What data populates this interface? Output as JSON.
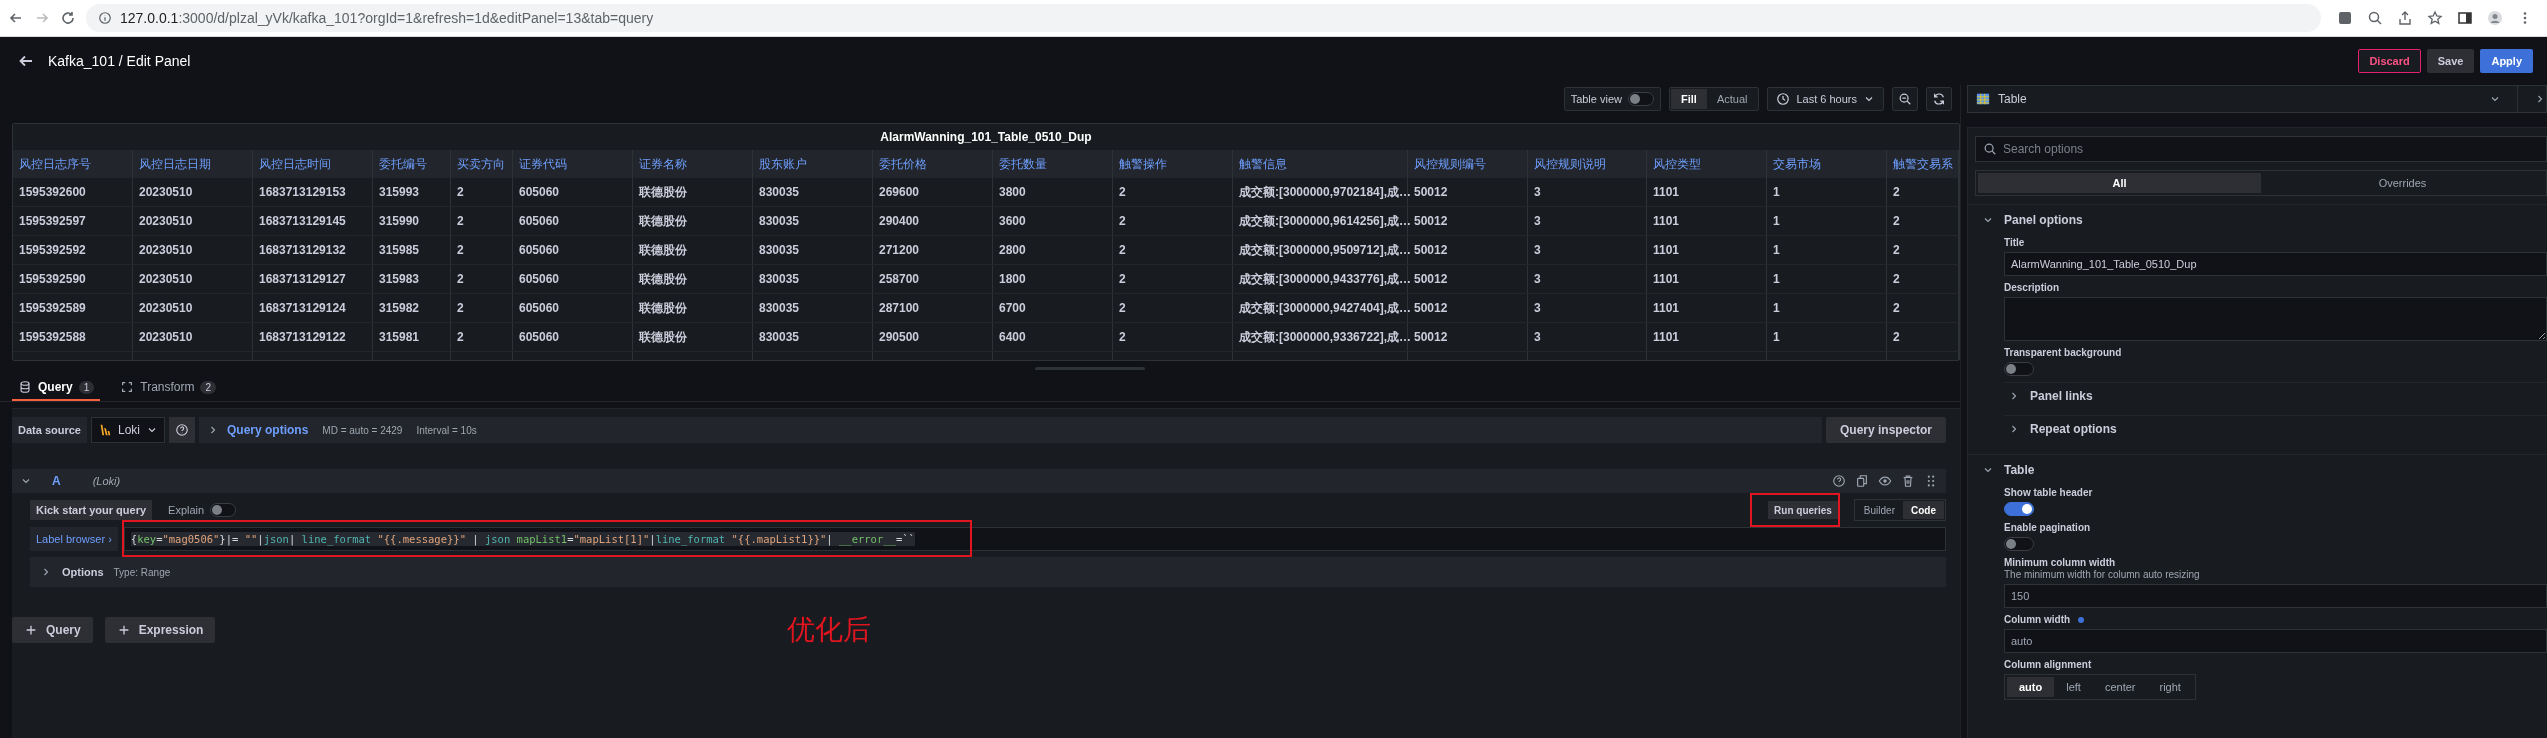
{
  "browser": {
    "host": "127.0.0.1",
    "path": ":3000/d/plzal_yVk/kafka_101?orgId=1&refresh=1d&editPanel=13&tab=query"
  },
  "header": {
    "title": "Kafka_101 / Edit Panel",
    "buttons": [
      {
        "label": "Discard",
        "kind": "danger"
      },
      {
        "label": "Save",
        "kind": "secondary"
      },
      {
        "label": "Apply",
        "kind": "primary"
      }
    ]
  },
  "toolbar": {
    "table_view": {
      "label": "Table view",
      "on": false
    },
    "size_modes": [
      {
        "label": "Fill",
        "selected": true
      },
      {
        "label": "Actual",
        "selected": false
      }
    ],
    "time_range": "Last 6 hours"
  },
  "panel": {
    "title": "AlarmWanning_101_Table_0510_Dup",
    "columns": [
      "风控日志序号",
      "风控日志日期",
      "风控日志时间",
      "委托编号",
      "买卖方向",
      "证券代码",
      "证券名称",
      "股东账户",
      "委托价格",
      "委托数量",
      "触警操作",
      "触警信息",
      "风控规则编号",
      "风控规则说明",
      "风控类型",
      "交易市场",
      "触警交易系"
    ],
    "rows": [
      [
        "1595392600",
        "20230510",
        "1683713129153",
        "315993",
        "2",
        "605060",
        "联德股份",
        "830035",
        "269600",
        "3800",
        "2",
        "成交额:[3000000,9702184],成…",
        "50012",
        "3",
        "1101",
        "1",
        "2"
      ],
      [
        "1595392597",
        "20230510",
        "1683713129145",
        "315990",
        "2",
        "605060",
        "联德股份",
        "830035",
        "290400",
        "3600",
        "2",
        "成交额:[3000000,9614256],成…",
        "50012",
        "3",
        "1101",
        "1",
        "2"
      ],
      [
        "1595392592",
        "20230510",
        "1683713129132",
        "315985",
        "2",
        "605060",
        "联德股份",
        "830035",
        "271200",
        "2800",
        "2",
        "成交额:[3000000,9509712],成…",
        "50012",
        "3",
        "1101",
        "1",
        "2"
      ],
      [
        "1595392590",
        "20230510",
        "1683713129127",
        "315983",
        "2",
        "605060",
        "联德股份",
        "830035",
        "258700",
        "1800",
        "2",
        "成交额:[3000000,9433776],成…",
        "50012",
        "3",
        "1101",
        "1",
        "2"
      ],
      [
        "1595392589",
        "20230510",
        "1683713129124",
        "315982",
        "2",
        "605060",
        "联德股份",
        "830035",
        "287100",
        "6700",
        "2",
        "成交额:[3000000,9427404],成…",
        "50012",
        "3",
        "1101",
        "1",
        "2"
      ],
      [
        "1595392588",
        "20230510",
        "1683713129122",
        "315981",
        "2",
        "605060",
        "联德股份",
        "830035",
        "290500",
        "6400",
        "2",
        "成交额:[3000000,9336722],成…",
        "50012",
        "3",
        "1101",
        "1",
        "2"
      ]
    ]
  },
  "query_tabs": [
    {
      "label": "Query",
      "count": "1",
      "selected": true
    },
    {
      "label": "Transform",
      "count": "2",
      "selected": false
    }
  ],
  "data_source": {
    "label": "Data source",
    "value": "Loki",
    "query_options": "Query options",
    "max_data_points": "MD = auto = 2429",
    "interval": "Interval = 10s",
    "inspector": "Query inspector"
  },
  "query": {
    "ref": "A",
    "source": "(Loki)",
    "kick_start": "Kick start your query",
    "explain": {
      "label": "Explain",
      "on": false
    },
    "run": "Run queries",
    "modes": [
      {
        "label": "Builder",
        "selected": false
      },
      {
        "label": "Code",
        "selected": true
      }
    ],
    "label_browser": "Label browser ›",
    "expression": [
      {
        "text": "{",
        "kind": "plain"
      },
      {
        "text": "key",
        "kind": "label"
      },
      {
        "text": "=",
        "kind": "plain"
      },
      {
        "text": "\"mag0506\"",
        "kind": "string"
      },
      {
        "text": "}|= ",
        "kind": "plain"
      },
      {
        "text": "\"\"",
        "kind": "string"
      },
      {
        "text": "|",
        "kind": "plain"
      },
      {
        "text": "json",
        "kind": "func"
      },
      {
        "text": "| ",
        "kind": "plain"
      },
      {
        "text": "line_format",
        "kind": "func"
      },
      {
        "text": " \"{{.message}}\"",
        "kind": "string"
      },
      {
        "text": " | ",
        "kind": "plain"
      },
      {
        "text": "json",
        "kind": "func"
      },
      {
        "text": " mapList1",
        "kind": "label"
      },
      {
        "text": "=",
        "kind": "plain"
      },
      {
        "text": "\"mapList[1]\"",
        "kind": "string"
      },
      {
        "text": "|",
        "kind": "plain"
      },
      {
        "text": "line_format",
        "kind": "func"
      },
      {
        "text": " \"{{.mapList1}}\"",
        "kind": "string"
      },
      {
        "text": "| ",
        "kind": "plain"
      },
      {
        "text": "__error__",
        "kind": "label"
      },
      {
        "text": "=``",
        "kind": "plain"
      }
    ],
    "options_label": "Options",
    "options_type": "Type: Range"
  },
  "add_buttons": [
    "Query",
    "Expression"
  ],
  "annotation": "优化后",
  "options_pane": {
    "visualization": "Table",
    "search_placeholder": "Search options",
    "tabs": [
      {
        "label": "All",
        "selected": true
      },
      {
        "label": "Overrides",
        "selected": false
      }
    ],
    "sections": [
      {
        "title": "Panel options",
        "expanded": true,
        "items": [
          {
            "kind": "text",
            "label": "Title",
            "value": "AlarmWanning_101_Table_0510_Dup"
          },
          {
            "kind": "textarea",
            "label": "Description"
          },
          {
            "kind": "switch",
            "label": "Transparent background",
            "on": false
          },
          {
            "kind": "subsection",
            "label": "Panel links"
          },
          {
            "kind": "subsection",
            "label": "Repeat options"
          }
        ]
      },
      {
        "title": "Table",
        "expanded": true,
        "items": [
          {
            "kind": "switch",
            "label": "Show table header",
            "on": true
          },
          {
            "kind": "switch",
            "label": "Enable pagination",
            "on": false
          },
          {
            "kind": "text",
            "label": "Minimum column width",
            "description": "The minimum width for column auto resizing",
            "placeholder": "150"
          },
          {
            "kind": "text",
            "label": "Column width",
            "modified": true,
            "placeholder": "auto"
          },
          {
            "kind": "radio",
            "label": "Column alignment",
            "options": [
              {
                "label": "auto",
                "selected": true
              },
              {
                "label": "left",
                "selected": false
              },
              {
                "label": "center",
                "selected": false
              },
              {
                "label": "right",
                "selected": false
              }
            ]
          }
        ]
      }
    ]
  }
}
